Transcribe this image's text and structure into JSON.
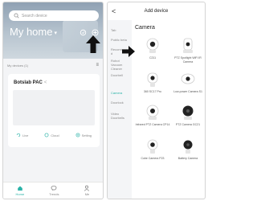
{
  "home": {
    "search_placeholder": "Search device",
    "title": "My home",
    "caret": "▾",
    "rooms_label": "My devices (1)",
    "rooms_menu": "≡",
    "device": {
      "name": "Botslab PAC",
      "share_mark": "<",
      "actions": [
        {
          "label": "Live",
          "icon": "live-icon"
        },
        {
          "label": "Cloud",
          "icon": "cloud-icon"
        },
        {
          "label": "Setting",
          "icon": "gear-icon"
        }
      ]
    },
    "nav": [
      {
        "label": "Home",
        "icon": "home-icon",
        "active": true
      },
      {
        "label": "Trends",
        "icon": "chat-icon",
        "active": false
      },
      {
        "label": "Me",
        "icon": "person-icon",
        "active": false
      }
    ]
  },
  "add_device": {
    "back": "<",
    "title": "Add device",
    "section": "Camera",
    "categories": [
      {
        "label": "Tab",
        "active": false
      },
      {
        "label": "Public beta",
        "active": false
      },
      {
        "label": "Recommende d",
        "active": false
      },
      {
        "label": "Robot Vacuum Cleaner",
        "active": false
      },
      {
        "label": "Doorbell",
        "active": false
      },
      {
        "label": "Camera",
        "active": true
      },
      {
        "label": "Doorlock",
        "active": false
      },
      {
        "label": "Video Doorbells",
        "active": false
      }
    ],
    "devices": [
      {
        "name": "C211",
        "icon": "camera-icon"
      },
      {
        "name": "PTZ Spotlight WiFi IR Camera",
        "icon": "camera-icon"
      },
      {
        "name": "360 SC17 Pro",
        "icon": "camera-icon"
      },
      {
        "name": "Low-power Camera S1",
        "icon": "camera-icon"
      },
      {
        "name": "Infrared PTZ Camera CP14",
        "icon": "camera-icon"
      },
      {
        "name": "PTZ Camera GC21",
        "icon": "camera-icon"
      },
      {
        "name": "Cube Camera P23",
        "icon": "camera-icon"
      },
      {
        "name": "Battery Camera",
        "icon": "camera-icon"
      }
    ]
  },
  "colors": {
    "accent": "#2bb3a8",
    "hero_top": "#8fa1b3",
    "background": "#f3f4f6"
  }
}
